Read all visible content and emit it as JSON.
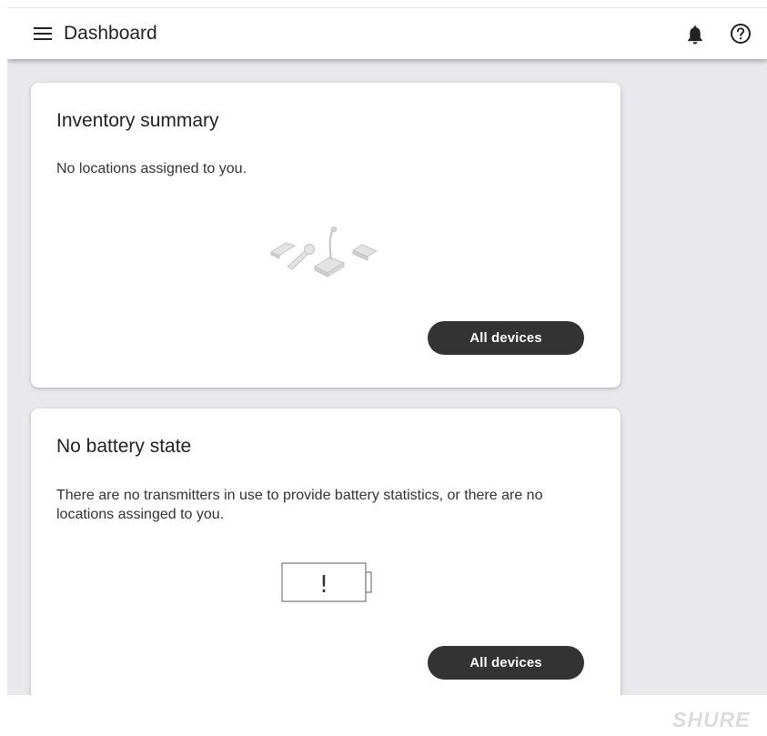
{
  "header": {
    "title": "Dashboard",
    "icons": {
      "menu": "hamburger-menu-icon",
      "notifications": "bell-icon",
      "help": "help-circle-icon"
    }
  },
  "cards": {
    "inventory": {
      "title": "Inventory summary",
      "message": "No locations assigned to you.",
      "illustration": "devices-illustration",
      "button_label": "All devices"
    },
    "battery": {
      "title": "No battery state",
      "message": "There are no transmitters in use to provide battery statistics, or there are no locations assinged to you.",
      "illustration": "battery-alert-illustration",
      "illustration_glyph": "!",
      "button_label": "All devices"
    }
  },
  "footer": {
    "brand": "SHURE"
  },
  "colors": {
    "background": "#e9e9ec",
    "card": "#ffffff",
    "button": "#333333",
    "button_text": "#ffffff",
    "brand_logo": "#dcdcdc"
  }
}
